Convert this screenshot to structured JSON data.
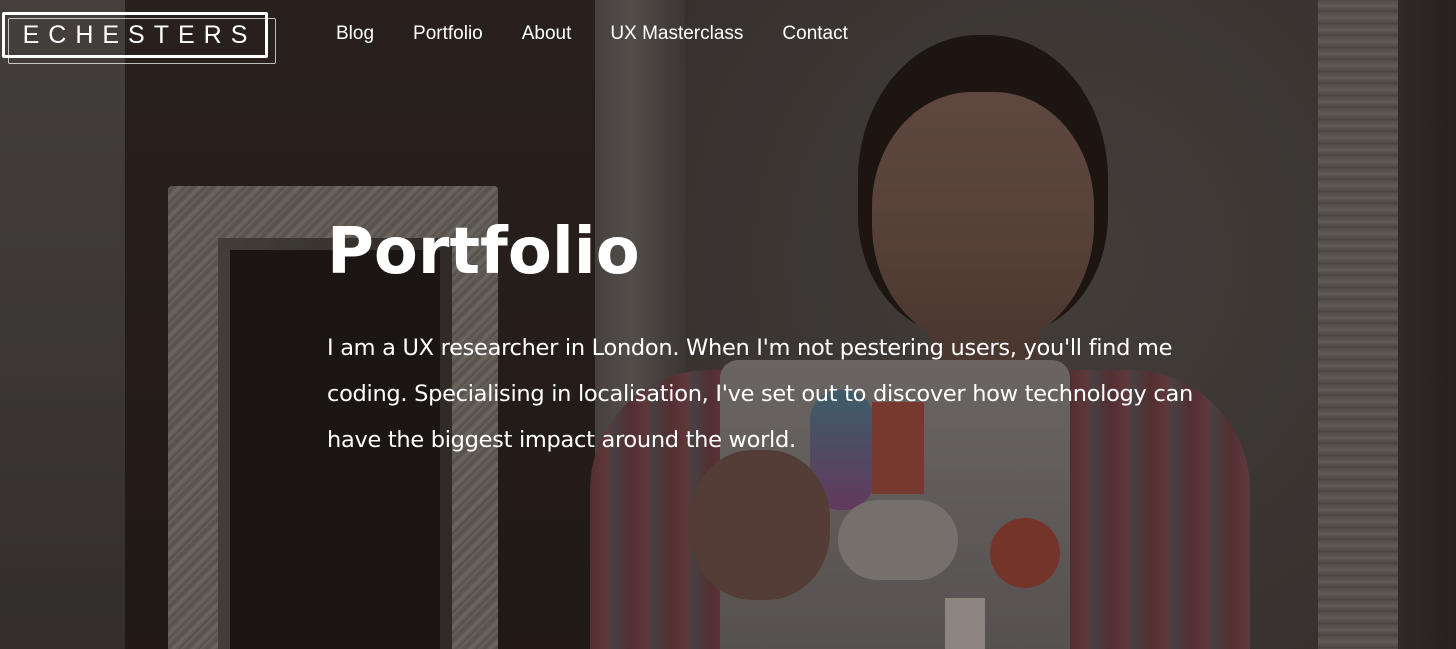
{
  "site": {
    "logo": "ECHESTERS"
  },
  "nav": {
    "items": [
      {
        "label": "Blog"
      },
      {
        "label": "Portfolio"
      },
      {
        "label": "About"
      },
      {
        "label": "UX Masterclass"
      },
      {
        "label": "Contact"
      }
    ]
  },
  "hero": {
    "title": "Portfolio",
    "intro": "I am a UX researcher in London. When I'm not pestering users, you'll find me coding. Specialising in localisation, I've set out to discover how technology can have the biggest impact around the world."
  },
  "colors": {
    "text": "#ffffff",
    "background": "#2a2522"
  }
}
